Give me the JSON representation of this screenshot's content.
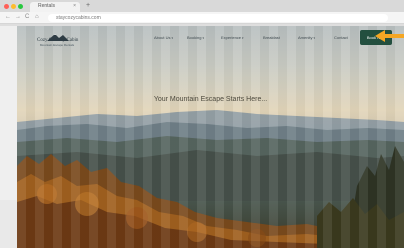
{
  "browser": {
    "tab_title": "Rentals",
    "tab_close": "×",
    "new_tab": "+",
    "nav_back": "←",
    "nav_forward": "→",
    "nav_reload": "C",
    "nav_home": "⌂",
    "url": "staycozycabins.com"
  },
  "site": {
    "logo_name": "Cozy Country Cabin",
    "logo_tagline": "Mountain Escape Rentals",
    "nav": [
      {
        "label": "About Us"
      },
      {
        "label": "Booking"
      },
      {
        "label": "Experience"
      },
      {
        "label": "Breakfast"
      },
      {
        "label": "Amenity"
      },
      {
        "label": "Contact"
      }
    ],
    "book_button": "Book Now",
    "hero_title": "Your Mountain Escape Starts Here..."
  },
  "colors": {
    "book_button_bg": "#234f3f",
    "cursor_highlight": "#f5a623"
  }
}
